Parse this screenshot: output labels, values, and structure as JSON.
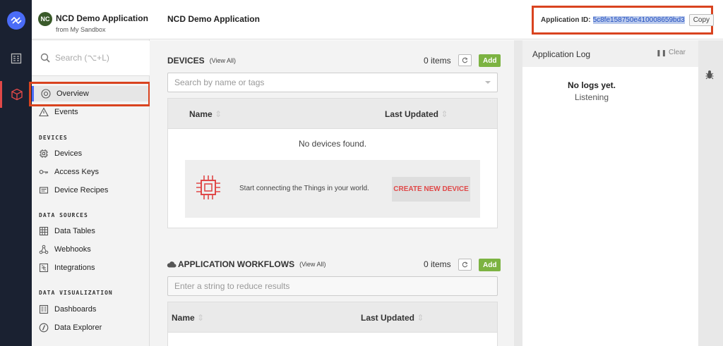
{
  "sidebar": {
    "app_badge": "NC",
    "app_title": "NCD Demo Application",
    "app_subtitle": "from My Sandbox",
    "search_placeholder": "Search (⌥+L)",
    "items": [
      {
        "label": "Overview",
        "icon": "eye-icon"
      },
      {
        "label": "Events",
        "icon": "warning-triangle-icon"
      }
    ],
    "sections": [
      {
        "title": "DEVICES",
        "items": [
          {
            "label": "Devices",
            "icon": "chip-icon"
          },
          {
            "label": "Access Keys",
            "icon": "key-icon"
          },
          {
            "label": "Device Recipes",
            "icon": "recipe-icon"
          }
        ]
      },
      {
        "title": "DATA SOURCES",
        "items": [
          {
            "label": "Data Tables",
            "icon": "table-icon"
          },
          {
            "label": "Webhooks",
            "icon": "webhook-icon"
          },
          {
            "label": "Integrations",
            "icon": "integration-icon"
          }
        ]
      },
      {
        "title": "DATA VISUALIZATION",
        "items": [
          {
            "label": "Dashboards",
            "icon": "dashboard-icon"
          },
          {
            "label": "Data Explorer",
            "icon": "explorer-icon"
          }
        ]
      }
    ]
  },
  "header": {
    "title": "NCD Demo Application",
    "app_id_label": "Application ID:",
    "app_id_value": "5c8fe158750e410008659bd3",
    "copy_label": "Copy"
  },
  "devices": {
    "title": "DEVICES",
    "view_all": "(View All)",
    "count": "0 items",
    "add_label": "Add",
    "search_placeholder": "Search by name or tags",
    "col_name": "Name",
    "col_updated": "Last Updated",
    "empty_text": "No devices found.",
    "cta_text": "Start connecting the Things in your world.",
    "cta_button": "CREATE NEW DEVICE"
  },
  "workflows": {
    "title": "APPLICATION WORKFLOWS",
    "view_all": "(View All)",
    "count": "0 items",
    "add_label": "Add",
    "filter_placeholder": "Enter a string to reduce results",
    "col_name": "Name",
    "col_updated": "Last Updated"
  },
  "log": {
    "title": "Application Log",
    "clear_label": "Clear",
    "empty_title": "No logs yet.",
    "empty_sub": "Listening"
  },
  "colors": {
    "rail_bg": "#1a2131",
    "accent": "#4a6cf7",
    "highlight": "#d9431f",
    "add_green": "#7cb342",
    "cta_red": "#e04848"
  }
}
